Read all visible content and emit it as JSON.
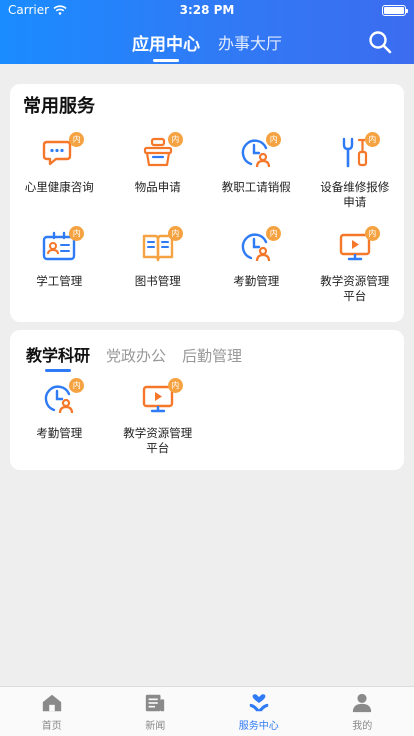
{
  "status_bar": {
    "carrier": "Carrier",
    "time": "3:28 PM"
  },
  "header": {
    "tabs": [
      {
        "label": "应用中心",
        "active": true
      },
      {
        "label": "办事大厅",
        "active": false
      }
    ],
    "search_icon": "search-icon"
  },
  "common_services": {
    "title": "常用服务",
    "badge_text": "内",
    "items": [
      {
        "label": "心里健康咨询",
        "icon": "chat-bubble-icon"
      },
      {
        "label": "物品申请",
        "icon": "basket-icon"
      },
      {
        "label": "教职工请销假",
        "icon": "clock-person-icon"
      },
      {
        "label": "设备维修报修申请",
        "icon": "wrench-icon"
      },
      {
        "label": "学工管理",
        "icon": "id-card-icon"
      },
      {
        "label": "图书管理",
        "icon": "book-icon"
      },
      {
        "label": "考勤管理",
        "icon": "clock-person-icon"
      },
      {
        "label": "教学资源管理平台",
        "icon": "video-screen-icon"
      }
    ]
  },
  "sections": {
    "tabs": [
      {
        "label": "教学科研",
        "active": true
      },
      {
        "label": "党政办公",
        "active": false
      },
      {
        "label": "后勤管理",
        "active": false
      }
    ],
    "items": [
      {
        "label": "考勤管理",
        "icon": "clock-person-icon"
      },
      {
        "label": "教学资源管理平台",
        "icon": "video-screen-icon"
      }
    ]
  },
  "bottom_nav": [
    {
      "label": "首页",
      "icon": "home-icon",
      "active": false
    },
    {
      "label": "新闻",
      "icon": "news-icon",
      "active": false
    },
    {
      "label": "服务中心",
      "icon": "heart-hands-icon",
      "active": true
    },
    {
      "label": "我的",
      "icon": "user-icon",
      "active": false
    }
  ],
  "colors": {
    "primary": "#2f7bf6",
    "icon_orange": "#f5772a",
    "icon_blue": "#2f7bf6",
    "badge": "#f5a342"
  }
}
